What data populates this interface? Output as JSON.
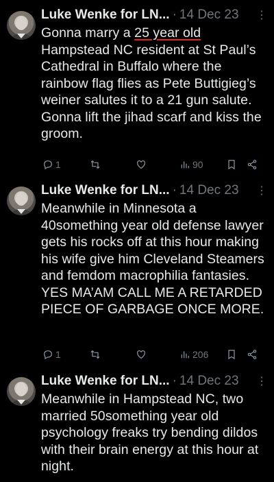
{
  "tweets": [
    {
      "name": "Luke Wenke for LN...",
      "date": "14 Dec 23",
      "text_before": "Gonna marry a ",
      "text_underlined": "25 year old",
      "text_after": " Hampstead NC resident at St Paul’s Cathedral in Buffalo where the rainbow flag flies as Pete Buttigieg’s weiner salutes it to a 21 gun salute.  Gonna lift the jihad scarf and kiss the groom.",
      "replies": "1",
      "views": "90"
    },
    {
      "name": "Luke Wenke for LN...",
      "date": "14 Dec 23",
      "text": "Meanwhile in Minnesota a 40something year old defense lawyer gets his rocks off at this hour making his wife give him Cleveland Steamers and femdom macrophilia fantasies.  YES MA’AM CALL ME A RETARDED PIECE OF GARBAGE ONCE MORE.",
      "replies": "1",
      "views": "206"
    },
    {
      "name": "Luke Wenke for LN...",
      "date": "14 Dec 23",
      "text": "Meanwhile in Hampstead NC, two married 50something year old psychology freaks try bending dildos with their brain energy at this hour at night."
    }
  ],
  "icons": {
    "reply": "reply-icon",
    "retweet": "retweet-icon",
    "like": "heart-icon",
    "views": "views-icon",
    "bookmark": "bookmark-icon",
    "share": "share-icon",
    "more": "more-icon"
  },
  "colors": {
    "background": "#000000",
    "text": "#e7e9ea",
    "muted": "#71767b",
    "underline": "#e0241b"
  }
}
